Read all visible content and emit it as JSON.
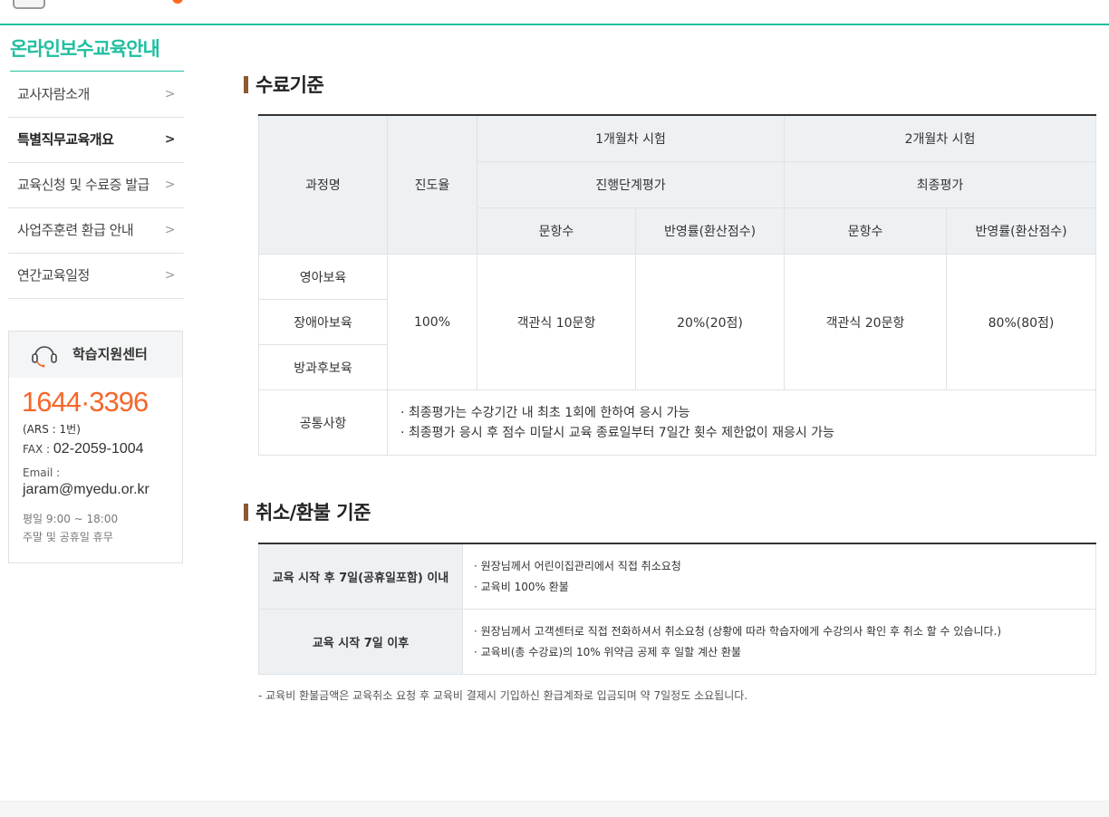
{
  "sidebar": {
    "title": "온라인보수교육안내",
    "items": [
      {
        "label": "교사자람소개",
        "arrow": ">"
      },
      {
        "label": "특별직무교육개요",
        "arrow": ">"
      },
      {
        "label": "교육신청 및 수료증 발급",
        "arrow": ">"
      },
      {
        "label": "사업주훈련 환급 안내",
        "arrow": ">"
      },
      {
        "label": "연간교육일정",
        "arrow": ">"
      }
    ],
    "active_index": 1
  },
  "support": {
    "title": "학습지원센터",
    "phone": "1644·3396",
    "ars": "(ARS : 1번)",
    "fax_label": "FAX : ",
    "fax": "02-2059-1004",
    "email_label": "Email :",
    "email": "jaram@myedu.or.kr",
    "hours_weekday": "평일 9:00 ~ 18:00",
    "hours_weekend": "주말 및 공휴일 휴무",
    "icon": "headset-icon"
  },
  "completion": {
    "title": "수료기준",
    "headers": {
      "course": "과정명",
      "progress": "진도율",
      "month1": "1개월차 시험",
      "month2": "2개월차 시험",
      "mid_eval": "진행단계평가",
      "final_eval": "최종평가",
      "count": "문항수",
      "weight": "반영률(환산점수)"
    },
    "courses": [
      "영아보육",
      "장애아보육",
      "방과후보육"
    ],
    "progress": "100%",
    "m1_count": "객관식 10문항",
    "m1_weight": "20%(20점)",
    "m2_count": "객관식 20문항",
    "m2_weight": "80%(80점)",
    "common_label": "공통사항",
    "common_notes": [
      "· 최종평가는 수강기간 내 최초 1회에 한하여 응시 가능",
      "· 최종평가 응시 후 점수 미달시 교육 종료일부터 7일간 횟수 제한없이 재응시 가능"
    ]
  },
  "refund": {
    "title": "취소/환불 기준",
    "rows": [
      {
        "label": "교육 시작 후 7일(공휴일포함) 이내",
        "lines": [
          "· 원장님께서 어린이집관리에서 직접 취소요청",
          "· 교육비 100% 환불"
        ]
      },
      {
        "label": "교육 시작 7일 이후",
        "lines": [
          "· 원장님께서 고객센터로 직접 전화하셔서 취소요청 (상황에 따라 학습자에게 수강의사 확인 후 취소 할 수 있습니다.)",
          "· 교육비(총 수강료)의 10% 위약금 공제 후 일할 계산 환불"
        ]
      }
    ],
    "note": "- 교육비 환불금액은 교육취소 요청 후 교육비 결제시 기입하신 환급계좌로 입금되며 약 7일정도 소요됩니다."
  },
  "colors": {
    "accent": "#1fbf9f",
    "phone": "#f5672a",
    "title_bar": "#8c5a2e",
    "header_bg": "#eef1f3"
  }
}
